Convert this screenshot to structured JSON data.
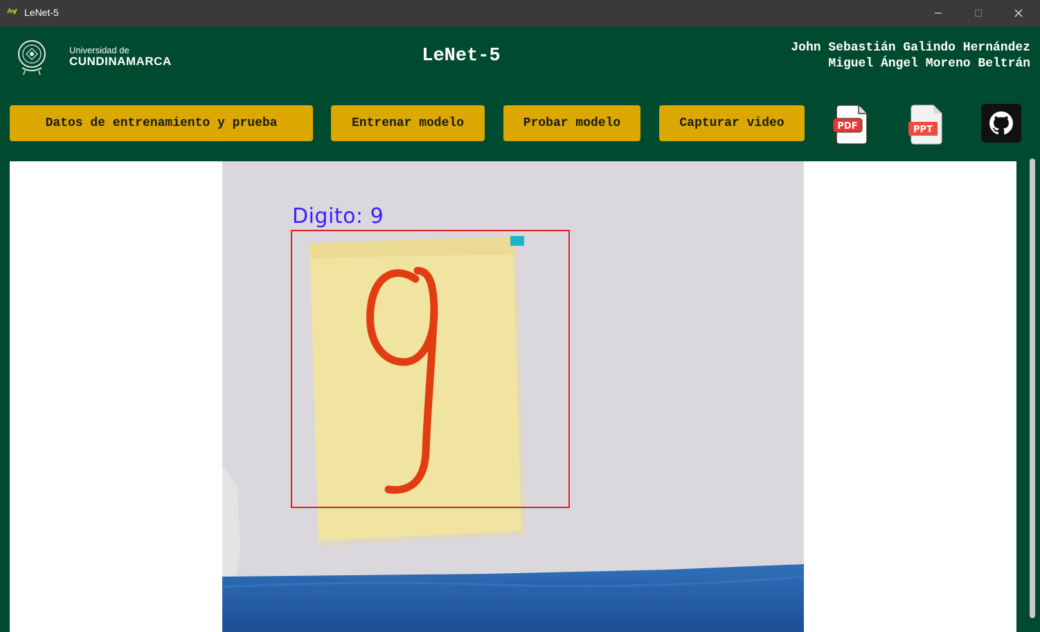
{
  "window": {
    "title": "LeNet-5",
    "icon": "app-icon"
  },
  "header": {
    "logo": {
      "line1": "Universidad de",
      "line2": "CUNDINAMARCA"
    },
    "title": "LeNet-5",
    "authors": [
      "John Sebastián Galindo Hernández",
      "Miguel Ángel Moreno Beltrán"
    ]
  },
  "toolbar": {
    "buttons": [
      "Datos de entrenamiento y prueba",
      "Entrenar modelo",
      "Probar modelo",
      "Capturar video"
    ],
    "icons": {
      "pdf_label": "PDF",
      "ppt_label": "PPT",
      "github": "github-icon"
    }
  },
  "detection": {
    "label": "Digito: 9",
    "box_color": "#e02020",
    "text_color": "#3a1cff"
  },
  "colors": {
    "header_bg": "#004a2f",
    "button_bg": "#dba700",
    "titlebar_bg": "#3a3a3a"
  }
}
